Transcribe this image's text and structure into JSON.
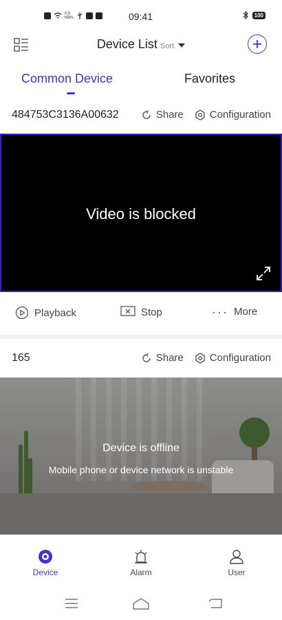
{
  "status_bar": {
    "time": "09:41",
    "battery": "100"
  },
  "header": {
    "title": "Device List",
    "sort_label": "Sort"
  },
  "tabs": [
    {
      "label": "Common Device",
      "active": true
    },
    {
      "label": "Favorites",
      "active": false
    }
  ],
  "devices": [
    {
      "name": "484753C3136A00632",
      "share_label": "Share",
      "config_label": "Configuration",
      "video_status": "Video is blocked",
      "controls": {
        "playback": "Playback",
        "stop": "Stop",
        "more": "More"
      }
    },
    {
      "name": "165",
      "share_label": "Share",
      "config_label": "Configuration",
      "offline_title": "Device is offline",
      "offline_subtitle": "Mobile phone or device network is unstable"
    }
  ],
  "bottom_nav": [
    {
      "label": "Device",
      "icon": "device-icon",
      "active": true
    },
    {
      "label": "Alarm",
      "icon": "alarm-icon",
      "active": false
    },
    {
      "label": "User",
      "icon": "user-icon",
      "active": false
    }
  ],
  "colors": {
    "accent": "#4a2fc9",
    "video_border": "#3b1fb5"
  }
}
